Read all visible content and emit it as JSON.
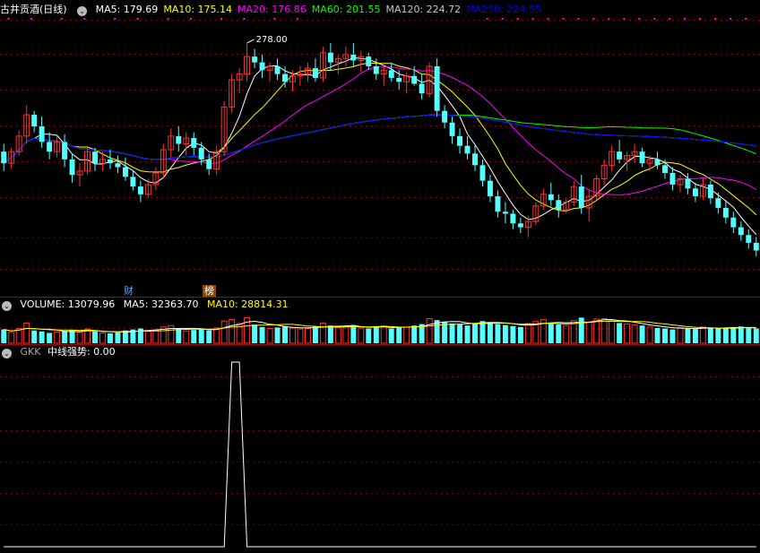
{
  "header": {
    "stock_name": "古井贡酒",
    "period": "(日线)",
    "ma_items": [
      {
        "label": "MA5: 179.69",
        "color": "#ffffff"
      },
      {
        "label": "MA10: 175.14",
        "color": "#ffff00"
      },
      {
        "label": "MA20: 176.86",
        "color": "#ff00ff"
      },
      {
        "label": "MA60: 201.55",
        "color": "#00ff00"
      },
      {
        "label": "MA120: 224.72",
        "color": "#c8c8c8"
      },
      {
        "label": "MA250: 224.55",
        "color": "#0000ff"
      }
    ]
  },
  "volume_header": {
    "title": "VOLUME: 13079.96",
    "ma5": "MA5: 32363.70",
    "ma10": "MA10: 28814.31"
  },
  "indicator_header": {
    "name": "GKK",
    "value_label": "中线强势: 0.00"
  },
  "annotations": {
    "high_label": "278.00",
    "finance_tag": "财",
    "rank_tag": "榜"
  },
  "colors": {
    "up": "#ff3232",
    "down": "#54ffff",
    "grid": "#800000",
    "panel_border": "#b00000"
  },
  "chart_data": [
    {
      "type": "candlestick",
      "title": "古井贡酒 (日线)",
      "series_count": 100,
      "ohlc": [
        [
          222,
          226,
          212,
          216
        ],
        [
          216,
          224,
          213,
          222
        ],
        [
          222,
          233,
          220,
          230
        ],
        [
          230,
          246,
          226,
          241
        ],
        [
          241,
          243,
          232,
          235
        ],
        [
          235,
          240,
          224,
          227
        ],
        [
          227,
          232,
          218,
          222
        ],
        [
          222,
          230,
          219,
          227
        ],
        [
          227,
          231,
          214,
          218
        ],
        [
          218,
          221,
          206,
          210
        ],
        [
          210,
          216,
          204,
          212
        ],
        [
          212,
          225,
          210,
          222
        ],
        [
          222,
          224,
          212,
          216
        ],
        [
          216,
          222,
          212,
          218
        ],
        [
          218,
          223,
          213,
          216
        ],
        [
          216,
          220,
          211,
          214
        ],
        [
          214,
          219,
          207,
          209
        ],
        [
          209,
          212,
          202,
          204
        ],
        [
          204,
          207,
          196,
          200
        ],
        [
          200,
          208,
          198,
          205
        ],
        [
          205,
          214,
          202,
          211
        ],
        [
          211,
          226,
          208,
          223
        ],
        [
          223,
          234,
          219,
          230
        ],
        [
          230,
          235,
          222,
          226
        ],
        [
          226,
          232,
          220,
          229
        ],
        [
          229,
          232,
          220,
          224
        ],
        [
          224,
          227,
          215,
          218
        ],
        [
          218,
          221,
          210,
          213
        ],
        [
          213,
          225,
          210,
          222
        ],
        [
          222,
          248,
          220,
          245
        ],
        [
          245,
          262,
          242,
          259
        ],
        [
          259,
          265,
          252,
          262
        ],
        [
          262,
          278,
          258,
          271
        ],
        [
          271,
          275,
          265,
          268
        ],
        [
          268,
          272,
          260,
          264
        ],
        [
          264,
          268,
          258,
          266
        ],
        [
          266,
          270,
          259,
          262
        ],
        [
          262,
          266,
          255,
          258
        ],
        [
          258,
          264,
          253,
          261
        ],
        [
          261,
          266,
          256,
          262
        ],
        [
          262,
          268,
          258,
          265
        ],
        [
          265,
          270,
          258,
          260
        ],
        [
          260,
          276,
          258,
          273
        ],
        [
          273,
          278,
          264,
          268
        ],
        [
          268,
          272,
          262,
          270
        ],
        [
          270,
          276,
          266,
          272
        ],
        [
          272,
          278,
          266,
          269
        ],
        [
          269,
          274,
          263,
          271
        ],
        [
          271,
          273,
          264,
          266
        ],
        [
          266,
          270,
          259,
          262
        ],
        [
          262,
          266,
          256,
          264
        ],
        [
          264,
          268,
          258,
          260
        ],
        [
          260,
          264,
          254,
          258
        ],
        [
          258,
          263,
          252,
          261
        ],
        [
          261,
          266,
          256,
          257
        ],
        [
          257,
          262,
          249,
          252
        ],
        [
          252,
          268,
          250,
          266
        ],
        [
          266,
          270,
          240,
          243
        ],
        [
          243,
          246,
          234,
          237
        ],
        [
          237,
          240,
          226,
          230
        ],
        [
          230,
          234,
          221,
          225
        ],
        [
          225,
          230,
          218,
          221
        ],
        [
          221,
          226,
          212,
          215
        ],
        [
          215,
          218,
          204,
          207
        ],
        [
          207,
          210,
          196,
          199
        ],
        [
          199,
          202,
          188,
          191
        ],
        [
          191,
          196,
          185,
          190
        ],
        [
          190,
          192,
          182,
          185
        ],
        [
          185,
          188,
          180,
          183
        ],
        [
          183,
          189,
          178,
          186
        ],
        [
          186,
          196,
          184,
          194
        ],
        [
          194,
          203,
          192,
          200
        ],
        [
          200,
          206,
          194,
          197
        ],
        [
          197,
          200,
          188,
          192
        ],
        [
          192,
          198,
          190,
          196
        ],
        [
          196,
          207,
          194,
          204
        ],
        [
          204,
          210,
          190,
          193
        ],
        [
          193,
          202,
          186,
          199
        ],
        [
          199,
          210,
          197,
          208
        ],
        [
          208,
          218,
          205,
          215
        ],
        [
          215,
          225,
          212,
          222
        ],
        [
          222,
          228,
          216,
          218
        ],
        [
          218,
          222,
          212,
          220
        ],
        [
          220,
          226,
          216,
          222
        ],
        [
          222,
          224,
          214,
          216
        ],
        [
          216,
          220,
          212,
          218
        ],
        [
          218,
          222,
          213,
          215
        ],
        [
          215,
          218,
          208,
          211
        ],
        [
          211,
          214,
          202,
          205
        ],
        [
          205,
          210,
          201,
          208
        ],
        [
          208,
          211,
          200,
          203
        ],
        [
          203,
          206,
          196,
          199
        ],
        [
          199,
          208,
          197,
          205
        ],
        [
          205,
          207,
          195,
          198
        ],
        [
          198,
          201,
          190,
          193
        ],
        [
          193,
          197,
          185,
          188
        ],
        [
          188,
          191,
          180,
          183
        ],
        [
          183,
          186,
          176,
          179
        ],
        [
          179,
          182,
          172,
          175
        ],
        [
          175,
          178,
          168,
          171
        ]
      ],
      "ma_lines": [
        "MA5",
        "MA10",
        "MA20",
        "MA60",
        "MA120",
        "MA250"
      ],
      "high_annotation": 278.0
    },
    {
      "type": "bar",
      "title": "VOLUME",
      "values": [
        28000,
        22000,
        30000,
        41000,
        26000,
        24000,
        21000,
        23000,
        25000,
        27000,
        22000,
        29000,
        24000,
        21000,
        20000,
        22000,
        26000,
        28000,
        30000,
        24000,
        27000,
        33000,
        36000,
        30000,
        25000,
        27000,
        29000,
        26000,
        31000,
        45000,
        48000,
        40000,
        52000,
        38000,
        33000,
        30000,
        32000,
        35000,
        31000,
        29000,
        30000,
        34000,
        41000,
        36000,
        32000,
        33000,
        37000,
        31000,
        30000,
        34000,
        35000,
        30000,
        32000,
        33000,
        36000,
        39000,
        50000,
        47000,
        44000,
        40000,
        38000,
        36000,
        41000,
        45000,
        43000,
        39000,
        37000,
        35000,
        33000,
        40000,
        44000,
        48000,
        42000,
        38000,
        36000,
        46000,
        52000,
        43000,
        49000,
        50000,
        47000,
        41000,
        39000,
        37000,
        36000,
        33000,
        31000,
        30000,
        28000,
        32000,
        30000,
        29000,
        33000,
        31000,
        30000,
        32000,
        33000,
        34000,
        31000,
        30000
      ],
      "ma_lines": [
        "MA5",
        "MA10"
      ]
    },
    {
      "type": "line",
      "title": "GKK",
      "series": [
        {
          "name": "中线强势",
          "values": [
            0,
            0,
            0,
            0,
            0,
            0,
            0,
            0,
            0,
            0,
            0,
            0,
            0,
            0,
            0,
            0,
            0,
            0,
            0,
            0,
            0,
            0,
            0,
            0,
            0,
            0,
            0,
            0,
            0,
            0,
            1,
            1,
            0,
            0,
            0,
            0,
            0,
            0,
            0,
            0,
            0,
            0,
            0,
            0,
            0,
            0,
            0,
            0,
            0,
            0,
            0,
            0,
            0,
            0,
            0,
            0,
            0,
            0,
            0,
            0,
            0,
            0,
            0,
            0,
            0,
            0,
            0,
            0,
            0,
            0,
            0,
            0,
            0,
            0,
            0,
            0,
            0,
            0,
            0,
            0,
            0,
            0,
            0,
            0,
            0,
            0,
            0,
            0,
            0,
            0,
            0,
            0,
            0,
            0,
            0,
            0,
            0,
            0,
            0,
            0
          ]
        }
      ],
      "ylim": [
        0,
        1
      ]
    }
  ]
}
